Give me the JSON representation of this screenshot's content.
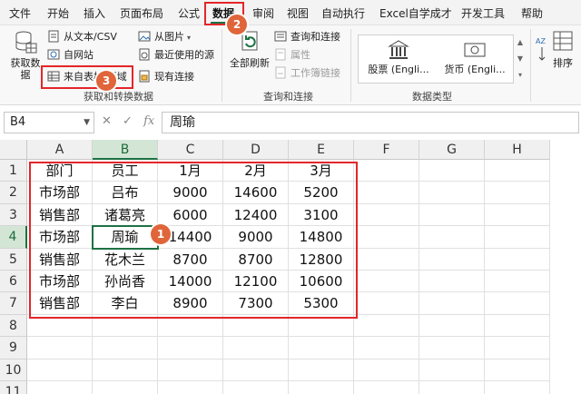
{
  "menu": {
    "tabs": [
      "文件",
      "开始",
      "插入",
      "页面布局",
      "公式",
      "数据",
      "审阅",
      "视图",
      "自动执行",
      "Excel自学成才",
      "开发工具",
      "帮助"
    ],
    "active_tab": "数据"
  },
  "ribbon": {
    "get_data": "获取数据",
    "from_text_csv": "从文本/CSV",
    "from_web": "自网站",
    "from_table_range": "来自表格/区域",
    "from_picture": "从图片",
    "recent_sources": "最近使用的源",
    "existing_connections": "现有连接",
    "group_get_transform": "获取和转换数据",
    "refresh_all": "全部刷新",
    "queries_connections": "查询和连接",
    "properties": "属性",
    "edit_links": "工作簿链接",
    "group_queries": "查询和连接",
    "stocks": "股票 (Engli...",
    "currency": "货币 (Engli...",
    "group_data_types": "数据类型",
    "sort": "排序"
  },
  "formula_bar": {
    "name_box": "B4",
    "cancel": "✕",
    "enter": "✓",
    "fx": "fx",
    "value": "周瑜"
  },
  "sheet": {
    "columns": [
      "A",
      "B",
      "C",
      "D",
      "E",
      "F",
      "G",
      "H"
    ],
    "rows": [
      "1",
      "2",
      "3",
      "4",
      "5",
      "6",
      "7",
      "8",
      "9",
      "10",
      "11"
    ],
    "active_cell": "B4",
    "table": [
      [
        "部门",
        "员工",
        "1月",
        "2月",
        "3月"
      ],
      [
        "市场部",
        "吕布",
        "9000",
        "14600",
        "5200"
      ],
      [
        "销售部",
        "诸葛亮",
        "6000",
        "12400",
        "3100"
      ],
      [
        "市场部",
        "周瑜",
        "14400",
        "9000",
        "14800"
      ],
      [
        "销售部",
        "花木兰",
        "8700",
        "8700",
        "12800"
      ],
      [
        "市场部",
        "孙尚香",
        "14000",
        "12100",
        "10600"
      ],
      [
        "销售部",
        "李白",
        "8900",
        "7300",
        "5300"
      ]
    ]
  },
  "badges": [
    "1",
    "2",
    "3"
  ],
  "colors": {
    "highlight": "#e3262a",
    "badge": "#e0653a",
    "excel_green": "#1e7145"
  }
}
